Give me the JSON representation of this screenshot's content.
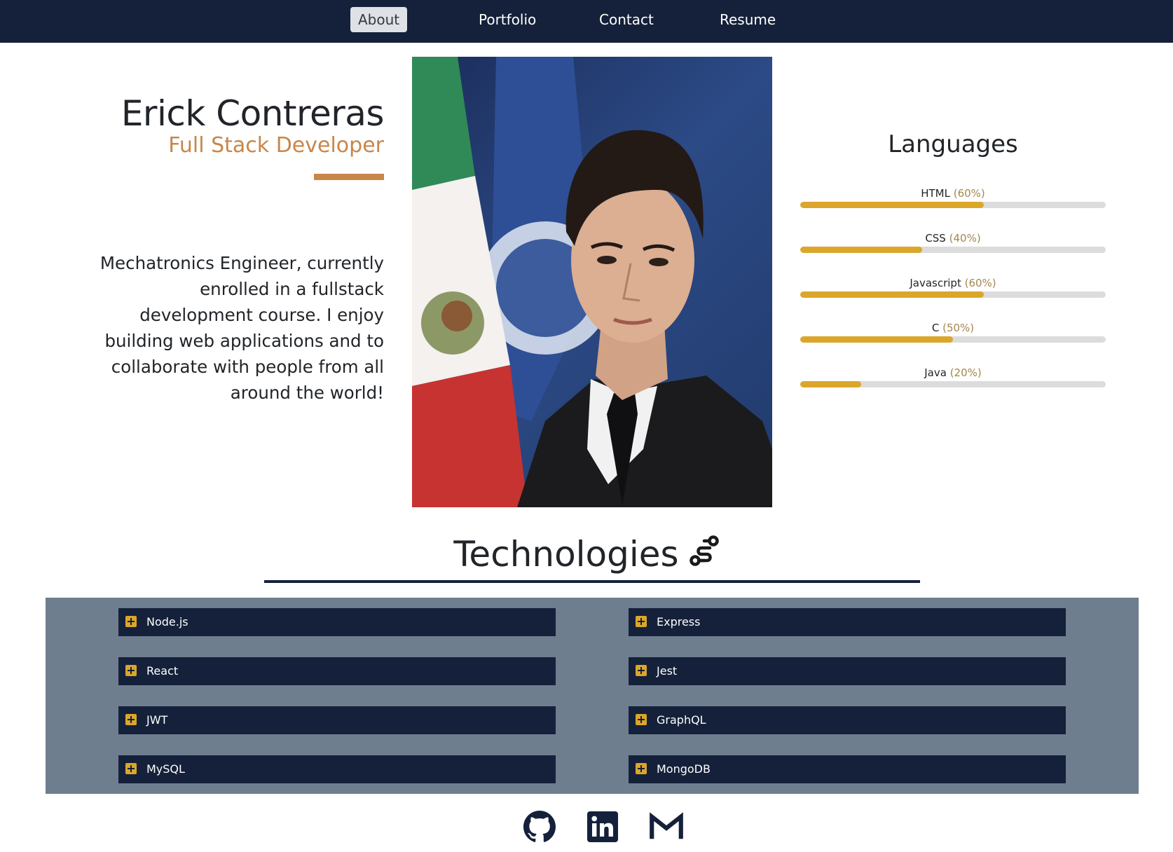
{
  "nav": {
    "items": [
      {
        "label": "About",
        "active": true
      },
      {
        "label": "Portfolio",
        "active": false
      },
      {
        "label": "Contact",
        "active": false
      },
      {
        "label": "Resume",
        "active": false
      }
    ]
  },
  "hero": {
    "name": "Erick Contreras",
    "role": "Full Stack Developer",
    "bio": "Mechatronics Engineer, currently enrolled in a fullstack development course. I enjoy building web applications and to collaborate with people from all around the world!"
  },
  "languages": {
    "title": "Languages",
    "items": [
      {
        "name": "HTML",
        "percent_label": "(60%)",
        "level": 0.6
      },
      {
        "name": "CSS",
        "percent_label": "(40%)",
        "level": 0.4
      },
      {
        "name": "Javascript",
        "percent_label": "(60%)",
        "level": 0.6
      },
      {
        "name": "C",
        "percent_label": "(50%)",
        "level": 0.5
      },
      {
        "name": "Java",
        "percent_label": "(20%)",
        "level": 0.2
      }
    ]
  },
  "technologies": {
    "title": "Technologies",
    "title_icon": "route-icon",
    "items": [
      "Node.js",
      "Express",
      "React",
      "Jest",
      "JWT",
      "GraphQL",
      "MySQL",
      "MongoDB"
    ]
  },
  "social": [
    {
      "icon": "github-icon"
    },
    {
      "icon": "linkedin-icon"
    },
    {
      "icon": "gmail-icon"
    }
  ],
  "colors": {
    "nav_bg": "#15213a",
    "accent": "#c8864a",
    "skill_fill": "#dba629",
    "tech_panel": "#6e7e8e"
  }
}
